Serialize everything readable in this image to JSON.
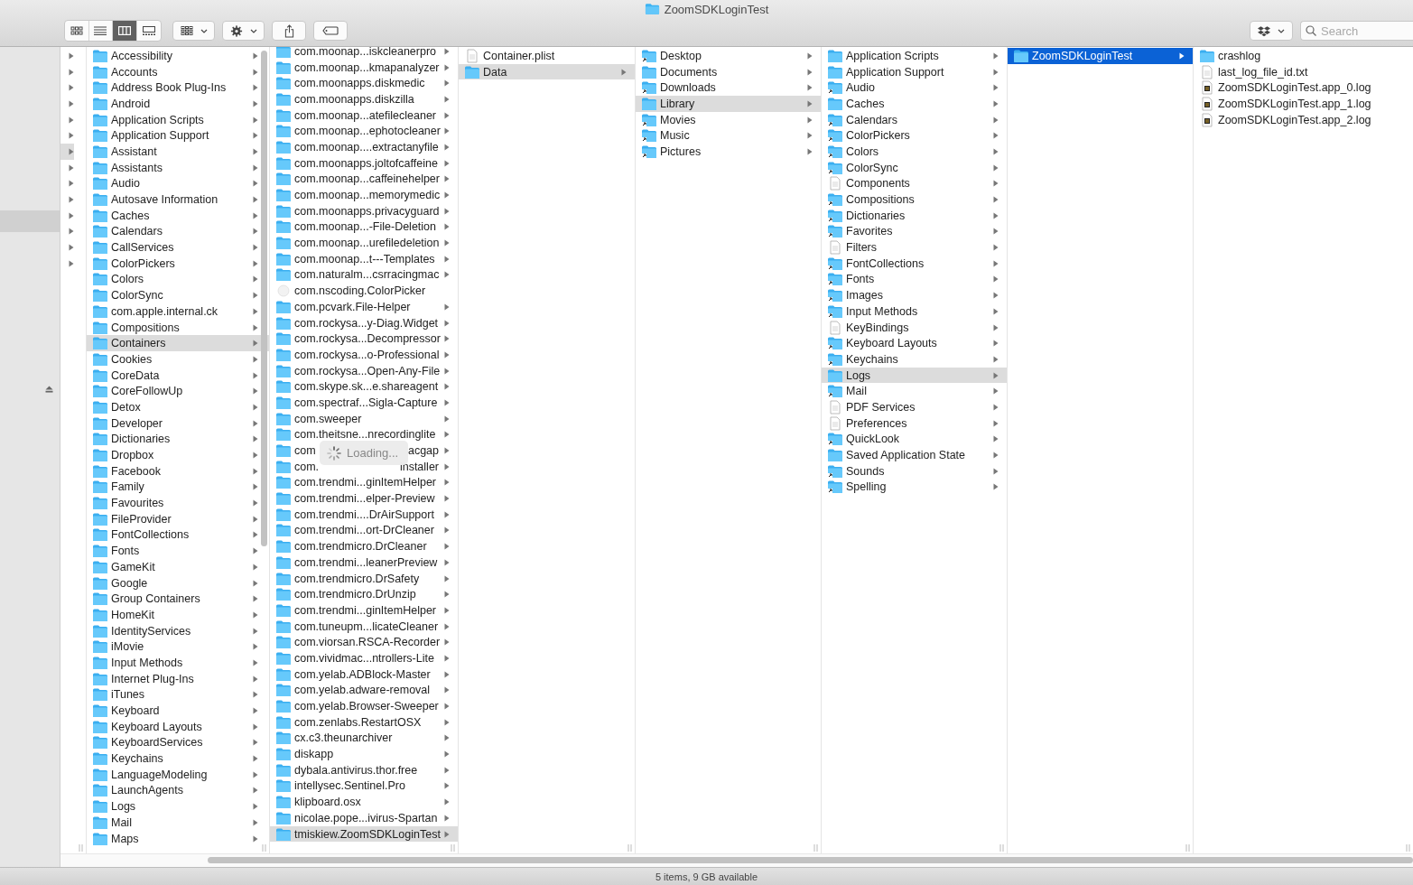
{
  "window": {
    "title": "ZoomSDKLoginTest"
  },
  "toolbar": {
    "views": [
      {
        "kind": "icon",
        "selected": false
      },
      {
        "kind": "list",
        "selected": false
      },
      {
        "kind": "column",
        "selected": true
      },
      {
        "kind": "gallery",
        "selected": false
      }
    ],
    "search": {
      "placeholder": "Search"
    }
  },
  "loading": {
    "label": "Loading..."
  },
  "columns": [
    {
      "active": false,
      "items": [
        {
          "expandable": true,
          "selected": false
        },
        {
          "expandable": true,
          "selected": false
        },
        {
          "expandable": true,
          "selected": false
        },
        {
          "expandable": true,
          "selected": false
        },
        {
          "expandable": true,
          "selected": false
        },
        {
          "expandable": true,
          "selected": false
        },
        {
          "expandable": true,
          "selected": true
        },
        {
          "expandable": true,
          "selected": false
        },
        {
          "expandable": true,
          "selected": false
        },
        {
          "expandable": true,
          "selected": false
        },
        {
          "expandable": true,
          "selected": false
        },
        {
          "expandable": true,
          "selected": false
        },
        {
          "expandable": true,
          "selected": false
        },
        {
          "expandable": true,
          "selected": false
        }
      ]
    },
    {
      "active": false,
      "items": [
        {
          "name": "Accessibility",
          "kind": "folder",
          "expandable": true,
          "selected": false
        },
        {
          "name": "Accounts",
          "kind": "folder",
          "expandable": true,
          "selected": false
        },
        {
          "name": "Address Book Plug-Ins",
          "kind": "folder",
          "expandable": true,
          "selected": false
        },
        {
          "name": "Android",
          "kind": "folder",
          "expandable": true,
          "selected": false
        },
        {
          "name": "Application Scripts",
          "kind": "folder",
          "expandable": true,
          "selected": false
        },
        {
          "name": "Application Support",
          "kind": "folder",
          "expandable": true,
          "selected": false
        },
        {
          "name": "Assistant",
          "kind": "folder",
          "expandable": true,
          "selected": false
        },
        {
          "name": "Assistants",
          "kind": "folder",
          "expandable": true,
          "selected": false
        },
        {
          "name": "Audio",
          "kind": "folder",
          "expandable": true,
          "selected": false
        },
        {
          "name": "Autosave Information",
          "kind": "folder",
          "expandable": true,
          "selected": false
        },
        {
          "name": "Caches",
          "kind": "folder",
          "expandable": true,
          "selected": false
        },
        {
          "name": "Calendars",
          "kind": "folder",
          "expandable": true,
          "selected": false
        },
        {
          "name": "CallServices",
          "kind": "folder",
          "expandable": true,
          "selected": false
        },
        {
          "name": "ColorPickers",
          "kind": "folder",
          "expandable": true,
          "selected": false
        },
        {
          "name": "Colors",
          "kind": "folder",
          "expandable": true,
          "selected": false
        },
        {
          "name": "ColorSync",
          "kind": "folder",
          "expandable": true,
          "selected": false
        },
        {
          "name": "com.apple.internal.ck",
          "kind": "folder",
          "expandable": true,
          "selected": false
        },
        {
          "name": "Compositions",
          "kind": "folder",
          "expandable": true,
          "selected": false
        },
        {
          "name": "Containers",
          "kind": "folder",
          "expandable": true,
          "selected": true
        },
        {
          "name": "Cookies",
          "kind": "folder",
          "expandable": true,
          "selected": false
        },
        {
          "name": "CoreData",
          "kind": "folder",
          "expandable": true,
          "selected": false
        },
        {
          "name": "CoreFollowUp",
          "kind": "folder",
          "expandable": true,
          "selected": false
        },
        {
          "name": "Detox",
          "kind": "folder",
          "expandable": true,
          "selected": false
        },
        {
          "name": "Developer",
          "kind": "folder",
          "expandable": true,
          "selected": false
        },
        {
          "name": "Dictionaries",
          "kind": "folder",
          "expandable": true,
          "selected": false
        },
        {
          "name": "Dropbox",
          "kind": "folder",
          "expandable": true,
          "selected": false
        },
        {
          "name": "Facebook",
          "kind": "folder",
          "expandable": true,
          "selected": false
        },
        {
          "name": "Family",
          "kind": "folder",
          "expandable": true,
          "selected": false
        },
        {
          "name": "Favourites",
          "kind": "folder",
          "expandable": true,
          "selected": false
        },
        {
          "name": "FileProvider",
          "kind": "folder",
          "expandable": true,
          "selected": false
        },
        {
          "name": "FontCollections",
          "kind": "folder",
          "expandable": true,
          "selected": false
        },
        {
          "name": "Fonts",
          "kind": "folder",
          "expandable": true,
          "selected": false
        },
        {
          "name": "GameKit",
          "kind": "folder",
          "expandable": true,
          "selected": false
        },
        {
          "name": "Google",
          "kind": "folder",
          "expandable": true,
          "selected": false
        },
        {
          "name": "Group Containers",
          "kind": "folder",
          "expandable": true,
          "selected": false
        },
        {
          "name": "HomeKit",
          "kind": "folder",
          "expandable": true,
          "selected": false
        },
        {
          "name": "IdentityServices",
          "kind": "folder",
          "expandable": true,
          "selected": false
        },
        {
          "name": "iMovie",
          "kind": "folder",
          "expandable": true,
          "selected": false
        },
        {
          "name": "Input Methods",
          "kind": "folder",
          "expandable": true,
          "selected": false
        },
        {
          "name": "Internet Plug-Ins",
          "kind": "folder",
          "expandable": true,
          "selected": false
        },
        {
          "name": "iTunes",
          "kind": "folder",
          "expandable": true,
          "selected": false
        },
        {
          "name": "Keyboard",
          "kind": "folder",
          "expandable": true,
          "selected": false
        },
        {
          "name": "Keyboard Layouts",
          "kind": "folder",
          "expandable": true,
          "selected": false
        },
        {
          "name": "KeyboardServices",
          "kind": "folder",
          "expandable": true,
          "selected": false
        },
        {
          "name": "Keychains",
          "kind": "folder",
          "expandable": true,
          "selected": false
        },
        {
          "name": "LanguageModeling",
          "kind": "folder",
          "expandable": true,
          "selected": false
        },
        {
          "name": "LaunchAgents",
          "kind": "folder",
          "expandable": true,
          "selected": false
        },
        {
          "name": "Logs",
          "kind": "folder",
          "expandable": true,
          "selected": false
        },
        {
          "name": "Mail",
          "kind": "folder",
          "expandable": true,
          "selected": false
        },
        {
          "name": "Maps",
          "kind": "folder",
          "expandable": true,
          "selected": false
        }
      ]
    },
    {
      "active": false,
      "items": [
        {
          "name": "com.moonap...iskcleanerpro",
          "kind": "folder",
          "expandable": true,
          "selected": false
        },
        {
          "name": "com.moonap...kmapanalyzer",
          "kind": "folder",
          "expandable": true,
          "selected": false
        },
        {
          "name": "com.moonapps.diskmedic",
          "kind": "folder",
          "expandable": true,
          "selected": false
        },
        {
          "name": "com.moonapps.diskzilla",
          "kind": "folder",
          "expandable": true,
          "selected": false
        },
        {
          "name": "com.moonap...atefilecleaner",
          "kind": "folder",
          "expandable": true,
          "selected": false
        },
        {
          "name": "com.moonap...ephotocleaner",
          "kind": "folder",
          "expandable": true,
          "selected": false
        },
        {
          "name": "com.moonap....extractanyfile",
          "kind": "folder",
          "expandable": true,
          "selected": false
        },
        {
          "name": "com.moonapps.joltofcaffeine",
          "kind": "folder",
          "expandable": true,
          "selected": false
        },
        {
          "name": "com.moonap...caffeinehelper",
          "kind": "folder",
          "expandable": true,
          "selected": false
        },
        {
          "name": "com.moonap...memorymedic",
          "kind": "folder",
          "expandable": true,
          "selected": false
        },
        {
          "name": "com.moonapps.privacyguard",
          "kind": "folder",
          "expandable": true,
          "selected": false
        },
        {
          "name": "com.moonap...-File-Deletion",
          "kind": "folder",
          "expandable": true,
          "selected": false
        },
        {
          "name": "com.moonap...urefiledeletion",
          "kind": "folder",
          "expandable": true,
          "selected": false
        },
        {
          "name": "com.moonap...t---Templates",
          "kind": "folder",
          "expandable": true,
          "selected": false
        },
        {
          "name": "com.naturalm...csrracingmac",
          "kind": "folder",
          "expandable": true,
          "selected": false
        },
        {
          "name": "com.nscoding.ColorPicker",
          "kind": "plugin",
          "expandable": false,
          "selected": false
        },
        {
          "name": "com.pcvark.File-Helper",
          "kind": "folder",
          "expandable": true,
          "selected": false
        },
        {
          "name": "com.rockysa...y-Diag.Widget",
          "kind": "folder",
          "expandable": true,
          "selected": false
        },
        {
          "name": "com.rockysa...Decompressor",
          "kind": "folder",
          "expandable": true,
          "selected": false
        },
        {
          "name": "com.rockysa...o-Professional",
          "kind": "folder",
          "expandable": true,
          "selected": false
        },
        {
          "name": "com.rockysa...Open-Any-File",
          "kind": "folder",
          "expandable": true,
          "selected": false
        },
        {
          "name": "com.skype.sk...e.shareagent",
          "kind": "folder",
          "expandable": true,
          "selected": false
        },
        {
          "name": "com.spectraf...Sigla-Capture",
          "kind": "folder",
          "expandable": true,
          "selected": false
        },
        {
          "name": "com.sweeper",
          "kind": "folder",
          "expandable": true,
          "selected": false
        },
        {
          "name": "com.theitsne...nrecordinglite",
          "kind": "folder",
          "expandable": true,
          "selected": false
        },
        {
          "name": "com",
          "tail": "acgap",
          "kind": "folder",
          "expandable": true,
          "selected": false
        },
        {
          "name": "com.",
          "tail": "installer",
          "kind": "folder",
          "expandable": true,
          "selected": false
        },
        {
          "name": "com.trendmi...ginItemHelper",
          "kind": "folder",
          "expandable": true,
          "selected": false
        },
        {
          "name": "com.trendmi...elper-Preview",
          "kind": "folder",
          "expandable": true,
          "selected": false
        },
        {
          "name": "com.trendmi....DrAirSupport",
          "kind": "folder",
          "expandable": true,
          "selected": false
        },
        {
          "name": "com.trendmi...ort-DrCleaner",
          "kind": "folder",
          "expandable": true,
          "selected": false
        },
        {
          "name": "com.trendmicro.DrCleaner",
          "kind": "folder",
          "expandable": true,
          "selected": false
        },
        {
          "name": "com.trendmi...leanerPreview",
          "kind": "folder",
          "expandable": true,
          "selected": false
        },
        {
          "name": "com.trendmicro.DrSafety",
          "kind": "folder",
          "expandable": true,
          "selected": false
        },
        {
          "name": "com.trendmicro.DrUnzip",
          "kind": "folder",
          "expandable": true,
          "selected": false
        },
        {
          "name": "com.trendmi...ginItemHelper",
          "kind": "folder",
          "expandable": true,
          "selected": false
        },
        {
          "name": "com.tuneupm...licateCleaner",
          "kind": "folder",
          "expandable": true,
          "selected": false
        },
        {
          "name": "com.viorsan.RSCA-Recorder",
          "kind": "folder",
          "expandable": true,
          "selected": false
        },
        {
          "name": "com.vividmac...ntrollers-Lite",
          "kind": "folder",
          "expandable": true,
          "selected": false
        },
        {
          "name": "com.yelab.ADBlock-Master",
          "kind": "folder",
          "expandable": true,
          "selected": false
        },
        {
          "name": "com.yelab.adware-removal",
          "kind": "folder",
          "expandable": true,
          "selected": false
        },
        {
          "name": "com.yelab.Browser-Sweeper",
          "kind": "folder",
          "expandable": true,
          "selected": false
        },
        {
          "name": "com.zenlabs.RestartOSX",
          "kind": "folder",
          "expandable": true,
          "selected": false
        },
        {
          "name": "cx.c3.theunarchiver",
          "kind": "folder",
          "expandable": true,
          "selected": false
        },
        {
          "name": "diskapp",
          "kind": "folder",
          "expandable": true,
          "selected": false
        },
        {
          "name": "dybala.antivirus.thor.free",
          "kind": "folder",
          "expandable": true,
          "selected": false
        },
        {
          "name": "intellysec.Sentinel.Pro",
          "kind": "folder",
          "expandable": true,
          "selected": false
        },
        {
          "name": "klipboard.osx",
          "kind": "folder",
          "expandable": true,
          "selected": false
        },
        {
          "name": "nicolae.pope...ivirus-Spartan",
          "kind": "folder",
          "expandable": true,
          "selected": false
        },
        {
          "name": "tmiskiew.ZoomSDKLoginTest",
          "kind": "folder",
          "expandable": true,
          "selected": true
        }
      ]
    },
    {
      "active": false,
      "items": [
        {
          "name": "Container.plist",
          "kind": "document",
          "expandable": false,
          "selected": false
        },
        {
          "name": "Data",
          "kind": "folder",
          "expandable": true,
          "selected": true
        }
      ]
    },
    {
      "active": false,
      "items": [
        {
          "name": "Desktop",
          "kind": "alias",
          "expandable": true,
          "selected": false
        },
        {
          "name": "Documents",
          "kind": "folder",
          "expandable": true,
          "selected": false
        },
        {
          "name": "Downloads",
          "kind": "alias",
          "expandable": true,
          "selected": false
        },
        {
          "name": "Library",
          "kind": "folder",
          "expandable": true,
          "selected": true
        },
        {
          "name": "Movies",
          "kind": "alias",
          "expandable": true,
          "selected": false
        },
        {
          "name": "Music",
          "kind": "alias",
          "expandable": true,
          "selected": false
        },
        {
          "name": "Pictures",
          "kind": "alias",
          "expandable": true,
          "selected": false
        }
      ]
    },
    {
      "active": false,
      "items": [
        {
          "name": "Application Scripts",
          "kind": "folder",
          "expandable": true,
          "selected": false
        },
        {
          "name": "Application Support",
          "kind": "folder",
          "expandable": true,
          "selected": false
        },
        {
          "name": "Audio",
          "kind": "alias",
          "expandable": true,
          "selected": false
        },
        {
          "name": "Caches",
          "kind": "folder",
          "expandable": true,
          "selected": false
        },
        {
          "name": "Calendars",
          "kind": "alias",
          "expandable": true,
          "selected": false
        },
        {
          "name": "ColorPickers",
          "kind": "alias",
          "expandable": true,
          "selected": false
        },
        {
          "name": "Colors",
          "kind": "alias",
          "expandable": true,
          "selected": false
        },
        {
          "name": "ColorSync",
          "kind": "alias",
          "expandable": true,
          "selected": false
        },
        {
          "name": "Components",
          "kind": "document",
          "expandable": true,
          "selected": false
        },
        {
          "name": "Compositions",
          "kind": "alias",
          "expandable": true,
          "selected": false
        },
        {
          "name": "Dictionaries",
          "kind": "alias",
          "expandable": true,
          "selected": false
        },
        {
          "name": "Favorites",
          "kind": "alias",
          "expandable": true,
          "selected": false
        },
        {
          "name": "Filters",
          "kind": "document",
          "expandable": true,
          "selected": false
        },
        {
          "name": "FontCollections",
          "kind": "alias",
          "expandable": true,
          "selected": false
        },
        {
          "name": "Fonts",
          "kind": "alias",
          "expandable": true,
          "selected": false
        },
        {
          "name": "Images",
          "kind": "alias",
          "expandable": true,
          "selected": false
        },
        {
          "name": "Input Methods",
          "kind": "alias",
          "expandable": true,
          "selected": false
        },
        {
          "name": "KeyBindings",
          "kind": "document",
          "expandable": true,
          "selected": false
        },
        {
          "name": "Keyboard Layouts",
          "kind": "alias",
          "expandable": true,
          "selected": false
        },
        {
          "name": "Keychains",
          "kind": "alias",
          "expandable": true,
          "selected": false
        },
        {
          "name": "Logs",
          "kind": "folder",
          "expandable": true,
          "selected": true
        },
        {
          "name": "Mail",
          "kind": "alias",
          "expandable": true,
          "selected": false
        },
        {
          "name": "PDF Services",
          "kind": "document",
          "expandable": true,
          "selected": false
        },
        {
          "name": "Preferences",
          "kind": "document",
          "expandable": true,
          "selected": false
        },
        {
          "name": "QuickLook",
          "kind": "alias",
          "expandable": true,
          "selected": false
        },
        {
          "name": "Saved Application State",
          "kind": "folder",
          "expandable": true,
          "selected": false
        },
        {
          "name": "Sounds",
          "kind": "alias",
          "expandable": true,
          "selected": false
        },
        {
          "name": "Spelling",
          "kind": "alias",
          "expandable": true,
          "selected": false
        }
      ]
    },
    {
      "active": true,
      "items": [
        {
          "name": "ZoomSDKLoginTest",
          "kind": "folder",
          "expandable": true,
          "selected": true
        }
      ]
    },
    {
      "items": [
        {
          "name": "crashlog",
          "kind": "folder",
          "expandable": false,
          "selected": false
        },
        {
          "name": "last_log_file_id.txt",
          "kind": "document",
          "expandable": false,
          "selected": false
        },
        {
          "name": "ZoomSDKLoginTest.app_0.log",
          "kind": "log",
          "expandable": false,
          "selected": false
        },
        {
          "name": "ZoomSDKLoginTest.app_1.log",
          "kind": "log",
          "expandable": false,
          "selected": false
        },
        {
          "name": "ZoomSDKLoginTest.app_2.log",
          "kind": "log",
          "expandable": false,
          "selected": false
        }
      ]
    }
  ],
  "status_bar": {
    "text": "5 items, 9 GB available"
  }
}
